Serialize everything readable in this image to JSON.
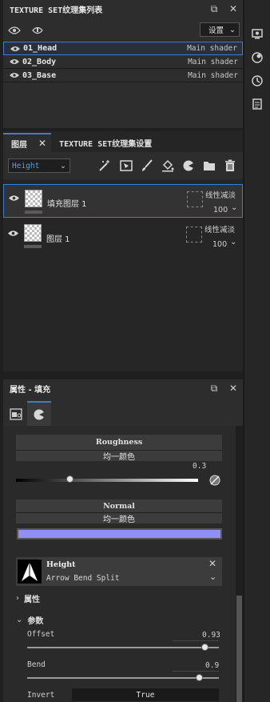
{
  "texture_set_list": {
    "title": "TEXTURE SET纹理集列表",
    "settings_label": "设置",
    "rows": [
      {
        "name": "01_Head",
        "shader": "Main shader",
        "selected": true
      },
      {
        "name": "02_Body",
        "shader": "Main shader",
        "selected": false
      },
      {
        "name": "03_Base",
        "shader": "Main shader",
        "selected": false
      }
    ]
  },
  "layers_panel": {
    "tab_layers": "图层",
    "tab_settings": "TEXTURE SET纹理集设置",
    "channel_select": "Height",
    "layers": [
      {
        "name": "填充图层 1",
        "blend": "线性减淡",
        "opacity": "100",
        "selected": true
      },
      {
        "name": "图层 1",
        "blend": "线性减淡",
        "opacity": "100",
        "selected": false
      }
    ]
  },
  "properties": {
    "title": "属性 - 填充",
    "roughness_label": "Roughness",
    "roughness_mode": "均一颜色",
    "roughness_value": "0.3",
    "roughness_fraction": 0.3,
    "normal_label": "Normal",
    "normal_mode": "均一颜色",
    "normal_color": "#8f8ff5",
    "height_label": "Height",
    "height_resource": "Arrow Bend Split",
    "attributes_section": "属性",
    "params_section": "参数",
    "offset_label": "Offset",
    "offset_value": "0.93",
    "offset_fraction": 0.93,
    "bend_label": "Bend",
    "bend_value": "0.9",
    "bend_fraction": 0.9,
    "invert_label": "Invert",
    "invert_value": "True"
  }
}
